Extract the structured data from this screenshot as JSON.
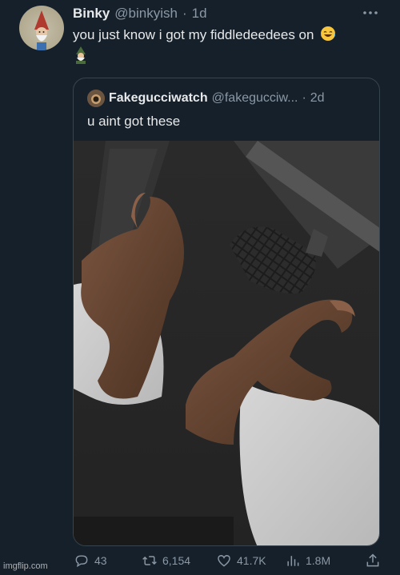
{
  "author": {
    "display_name": "Binky",
    "handle": "@binkyish",
    "separator": "·",
    "time": "1d"
  },
  "tweet": {
    "text": "you just know i got my fiddledeedees on",
    "emojis": [
      "face-with-tears-of-joy-icon",
      "mage-icon"
    ]
  },
  "quoted_tweet": {
    "display_name": "Fakegucciwatch",
    "handle": "@fakegucciw...",
    "separator": "·",
    "time": "2d",
    "text": "u aint got these"
  },
  "actions": {
    "replies": "43",
    "retweets": "6,154",
    "likes": "41.7K",
    "views": "1.8M"
  },
  "watermark": "imgflip.com",
  "colors": {
    "background": "#15202b",
    "text": "#e7e9ea",
    "secondary_text": "#8b98a5",
    "border": "#38444d"
  }
}
